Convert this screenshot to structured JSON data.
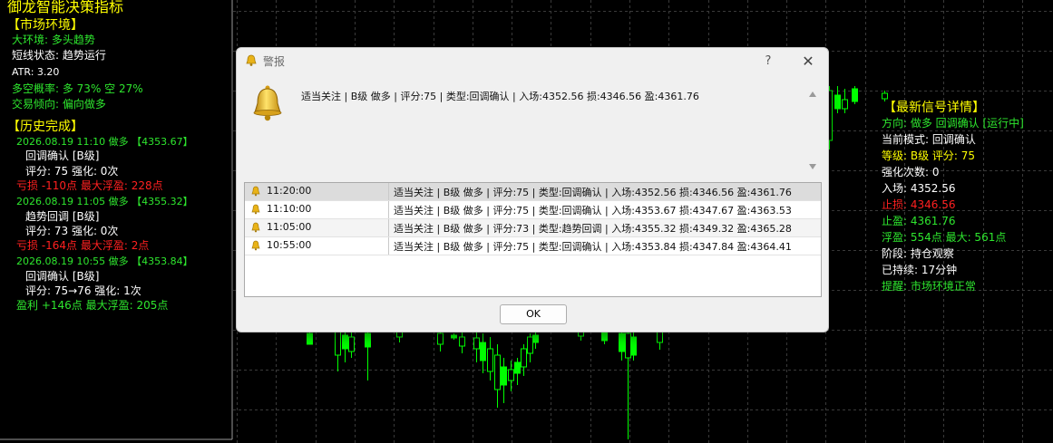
{
  "left_panel": {
    "title": "御龙智能决策指标",
    "market_header": "【市场环境】",
    "environment": "大环境: 多头趋势",
    "short_state": "短线状态: 趋势运行",
    "atr": "ATR: 3.20",
    "prob": "多空概率: 多 73% 空 27%",
    "tendency": "交易倾向: 偏向做多",
    "history_header": "【历史完成】",
    "history": [
      {
        "head": "2026.08.19 11:10 做多 【4353.67】",
        "type": "回调确认 [B级]",
        "score": "评分: 75 强化: 0次",
        "result": "亏损 -110点 最大浮盈: 228点",
        "result_color": "red"
      },
      {
        "head": "2026.08.19 11:05 做多 【4355.32】",
        "type": "趋势回调 [B级]",
        "score": "评分: 73 强化: 0次",
        "result": "亏损 -164点 最大浮盈: 2点",
        "result_color": "red"
      },
      {
        "head": "2026.08.19 10:55 做多 【4353.84】",
        "type": "回调确认 [B级]",
        "score": "评分: 75→76 强化: 1次",
        "result": "盈利 +146点 最大浮盈: 205点",
        "result_color": "green"
      }
    ]
  },
  "right_panel": {
    "header": "【最新信号详情】",
    "direction": "方向: 做多 回调确认 [运行中]",
    "mode": "当前模式: 回调确认",
    "grade": "等级: B级 评分: 75",
    "boost": "强化次数: 0",
    "entry": "入场: 4352.56",
    "stop": "止损: 4346.56",
    "target": "止盈: 4361.76",
    "floating": "浮盈: 554点 最大: 561点",
    "stage": "阶段: 持仓观察",
    "duration": "已持续: 17分钟",
    "reminder": "提醒: 市场环境正常"
  },
  "dialog": {
    "title": "警报",
    "help": "?",
    "close": "✕",
    "message": "适当关注 | B级 做多 | 评分:75 | 类型:回调确认 | 入场:4352.56 损:4346.56 盈:4361.76",
    "alerts": [
      {
        "time": "11:20:00",
        "text": "适当关注 | B级 做多 | 评分:75 | 类型:回调确认 | 入场:4352.56 损:4346.56 盈:4361.76"
      },
      {
        "time": "11:10:00",
        "text": "适当关注 | B级 做多 | 评分:75 | 类型:回调确认 | 入场:4353.67 损:4347.67 盈:4363.53"
      },
      {
        "time": "11:05:00",
        "text": "适当关注 | B级 做多 | 评分:73 | 类型:趋势回调 | 入场:4355.32 损:4349.32 盈:4365.28"
      },
      {
        "time": "10:55:00",
        "text": "适当关注 | B级 做多 | 评分:75 | 类型:回调确认 | 入场:4353.84 损:4347.84 盈:4364.41"
      }
    ],
    "ok": "OK"
  },
  "colors": {
    "background": "#000000",
    "grid": "#3a3a3a",
    "candle": "#00ff00",
    "yellow": "#ffff00",
    "green": "#2ee62e",
    "red": "#ff2020",
    "dialog_bg": "#f0f0f0"
  }
}
